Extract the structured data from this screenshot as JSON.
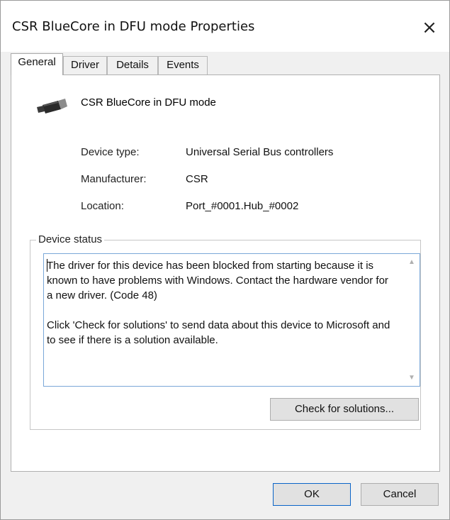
{
  "window": {
    "title": "CSR BlueCore in DFU mode Properties",
    "close_glyph": "×"
  },
  "tabs": [
    {
      "label": "General",
      "active": true
    },
    {
      "label": "Driver",
      "active": false
    },
    {
      "label": "Details",
      "active": false
    },
    {
      "label": "Events",
      "active": false
    }
  ],
  "device": {
    "icon": "usb-plug-icon",
    "name": "CSR BlueCore in DFU mode"
  },
  "properties": [
    {
      "label": "Device type:",
      "value": "Universal Serial Bus controllers"
    },
    {
      "label": "Manufacturer:",
      "value": "CSR"
    },
    {
      "label": "Location:",
      "value": "Port_#0001.Hub_#0002"
    }
  ],
  "status": {
    "legend": "Device status",
    "paragraph1": "The driver for this device has been blocked from starting because it is known to have problems with Windows. Contact the hardware vendor for a new driver. (Code 48)",
    "paragraph2": "Click 'Check for solutions' to send data about this device to Microsoft and to see if there is a solution available.",
    "check_button": "Check for solutions..."
  },
  "footer": {
    "ok_label": "OK",
    "cancel_label": "Cancel"
  },
  "colors": {
    "focus_border": "#7aa7d8",
    "default_button_border": "#0a64c8"
  }
}
